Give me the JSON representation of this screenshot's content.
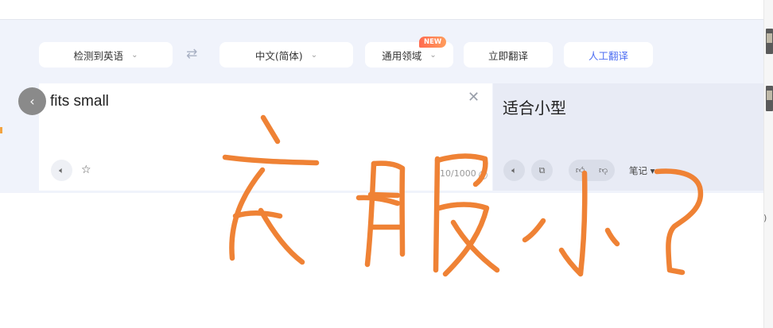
{
  "toolbar": {
    "source_lang": "检测到英语",
    "target_lang": "中文(简体)",
    "domain": "通用领域",
    "domain_badge": "NEW",
    "translate_button": "立即翻译",
    "human_translate_button": "人工翻译"
  },
  "source": {
    "text": "fits small",
    "counter": "10/1000"
  },
  "target": {
    "text": "适合小型",
    "notes_label": "笔记"
  },
  "annotation": {
    "handwritten_text": "衣服小?",
    "color": "#ef8235"
  },
  "colors": {
    "accent": "#4e6ef2",
    "panel_bg": "#f0f3fb",
    "target_bg": "#e8ebf5"
  }
}
